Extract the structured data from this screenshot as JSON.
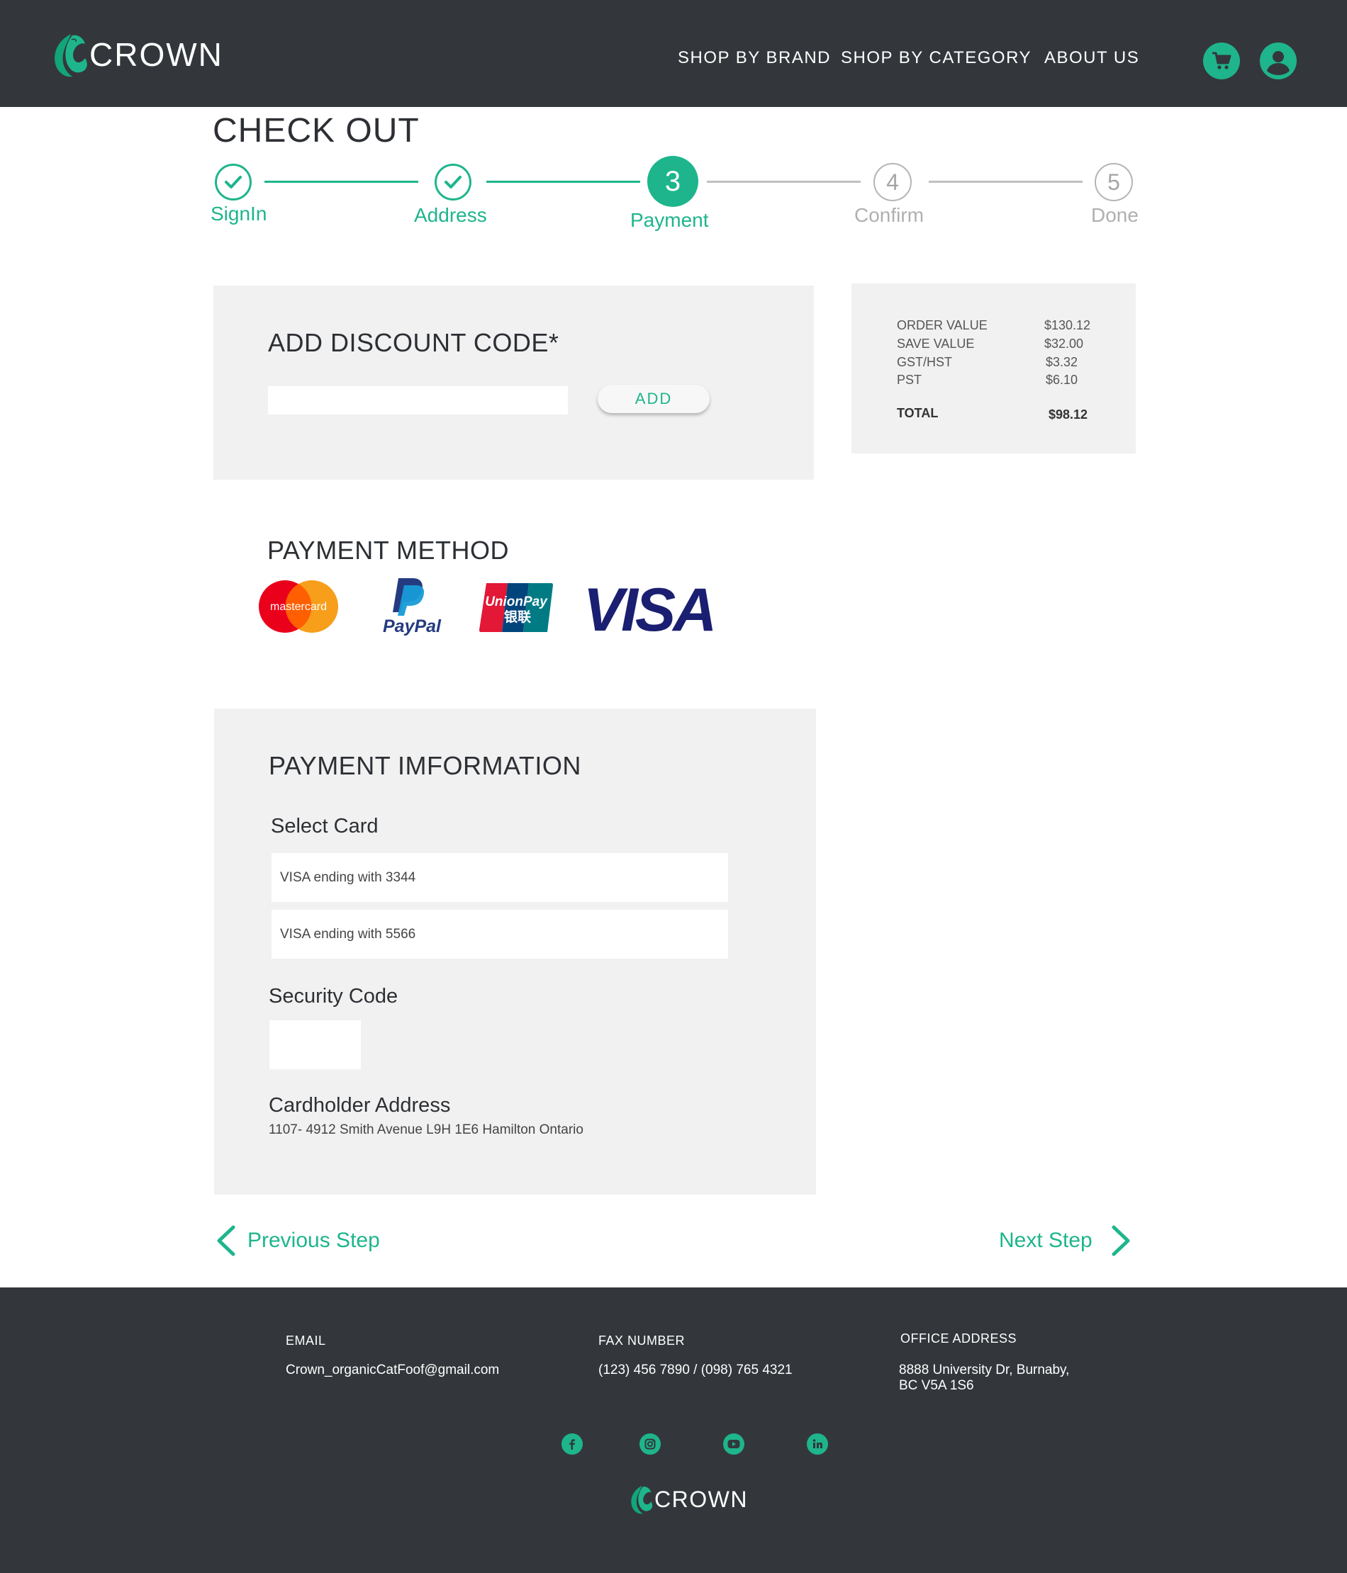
{
  "brand": {
    "name": "CROWN",
    "accent": "#1eb58c",
    "dark": "#33373b",
    "panel": "#f1f1f1"
  },
  "nav": {
    "shop_by_brand": "SHOP BY BRAND",
    "shop_by_category": "SHOP BY CATEGORY",
    "about_us": "ABOUT US"
  },
  "header_icons": {
    "cart": "cart-icon",
    "account": "user-icon"
  },
  "page": {
    "title": "CHECK OUT"
  },
  "stepper": {
    "steps": [
      {
        "label": "SignIn",
        "state": "done"
      },
      {
        "label": "Address",
        "state": "done"
      },
      {
        "label": "Payment",
        "number": "3",
        "state": "current"
      },
      {
        "label": "Confirm",
        "number": "4",
        "state": "todo"
      },
      {
        "label": "Done",
        "number": "5",
        "state": "todo"
      }
    ]
  },
  "discount": {
    "title": "ADD DISCOUNT CODE*",
    "input_value": "",
    "add_label": "ADD"
  },
  "summary": {
    "rows": [
      {
        "label": "ORDER VALUE",
        "value": "$130.12"
      },
      {
        "label": "SAVE VALUE",
        "value": "$32.00"
      },
      {
        "label": "GST/HST",
        "value": "$3.32"
      },
      {
        "label": "PST",
        "value": "$6.10"
      }
    ],
    "total_label": "TOTAL",
    "total_value": "$98.12"
  },
  "payment_method": {
    "title": "PAYMENT METHOD",
    "options": [
      {
        "name": "mastercard",
        "text": "mastercard"
      },
      {
        "name": "paypal",
        "text": "PayPal"
      },
      {
        "name": "unionpay",
        "text": "UnionPay",
        "subtext": "银联"
      },
      {
        "name": "visa",
        "text": "VISA"
      }
    ]
  },
  "payment_info": {
    "title": "PAYMENT IMFORMATION",
    "select_card_label": "Select Card",
    "cards": [
      "VISA ending with 3344",
      "VISA ending with 5566"
    ],
    "security_code_label": "Security Code",
    "security_code_value": "",
    "cardholder_address_label": "Cardholder Address",
    "cardholder_address": "1107- 4912  Smith Avenue L9H 1E6 Hamilton Ontario"
  },
  "navigation": {
    "previous": "Previous Step",
    "next": "Next Step"
  },
  "footer": {
    "email_head": "EMAIL",
    "email": "Crown_organicCatFoof@gmail.com",
    "fax_head": "FAX NUMBER",
    "fax": "(123) 456 7890 / (098) 765 4321",
    "office_head": "OFFICE ADDRESS",
    "office_line1": "8888 University Dr, Burnaby,",
    "office_line2": "BC V5A 1S6",
    "social": [
      "facebook-icon",
      "instagram-icon",
      "youtube-icon",
      "linkedin-icon"
    ]
  }
}
